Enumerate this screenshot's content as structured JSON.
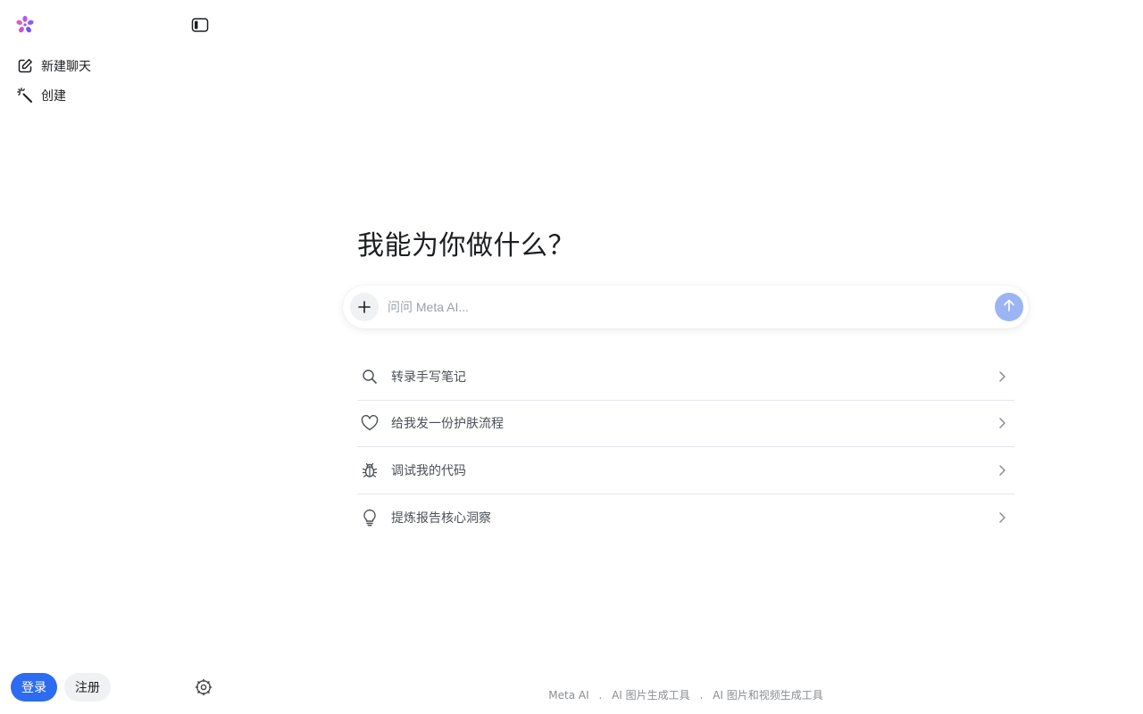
{
  "sidebar": {
    "logo_icon": "meta-ai-flower-icon",
    "collapse_icon": "sidebar-toggle-icon",
    "items": [
      {
        "label": "新建聊天",
        "icon": "edit-icon"
      },
      {
        "label": "创建",
        "icon": "magic-wand-icon"
      }
    ],
    "login_label": "登录",
    "signup_label": "注册",
    "settings_icon": "gear-icon"
  },
  "main": {
    "headline": "我能为你做什么？",
    "composer": {
      "placeholder": "问问 Meta AI...",
      "value": "",
      "attach_icon": "plus-icon",
      "send_icon": "arrow-up-icon"
    },
    "suggestions": [
      {
        "label": "转录手写笔记",
        "icon": "search-icon"
      },
      {
        "label": "给我发一份护肤流程",
        "icon": "heart-icon"
      },
      {
        "label": "调试我的代码",
        "icon": "bug-icon"
      },
      {
        "label": "提炼报告核心洞察",
        "icon": "lightbulb-icon"
      }
    ]
  },
  "footer": {
    "links": [
      "Meta AI",
      "AI 图片生成工具",
      "AI 图片和视频生成工具"
    ],
    "separator": "."
  },
  "colors": {
    "primary": "#2d6cf0",
    "send_disabled": "#9bb4f4",
    "text": "#1c1e21",
    "muted": "#8a8d91",
    "divider": "#e4e6eb"
  }
}
